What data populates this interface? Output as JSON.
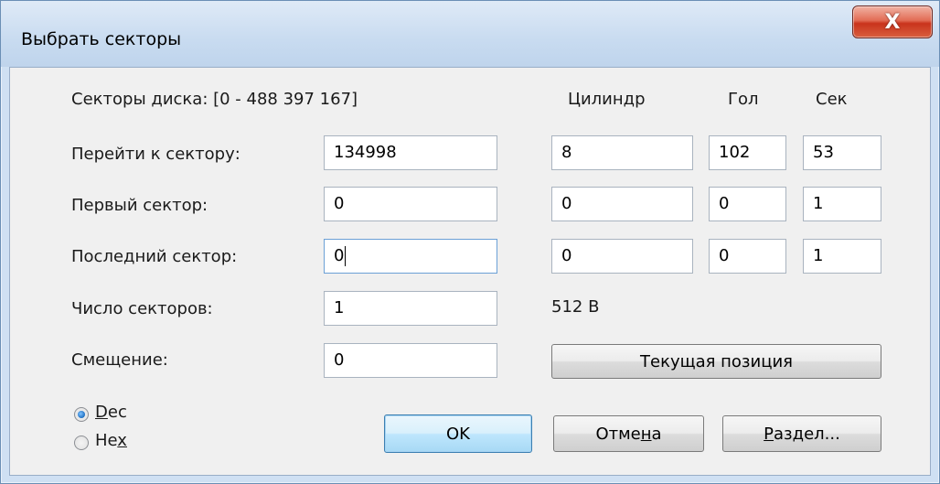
{
  "window": {
    "title": "Выбрать секторы",
    "close_label": "X"
  },
  "header": {
    "disk_range": "Секторы диска: [0 - 488 397 167]",
    "col_cylinder": "Цилиндр",
    "col_head": "Гол",
    "col_sector": "Сек"
  },
  "rows": {
    "goto": {
      "label": "Перейти к сектору:",
      "value": "134998",
      "cyl": "8",
      "head": "102",
      "sec": "53"
    },
    "first": {
      "label": "Первый сектор:",
      "value": "0",
      "cyl": "0",
      "head": "0",
      "sec": "1"
    },
    "last": {
      "label": "Последний сектор:",
      "value": "0",
      "cyl": "0",
      "head": "0",
      "sec": "1"
    },
    "count": {
      "label": "Число секторов:",
      "value": "1",
      "size": "512 B"
    },
    "offset": {
      "label": "Смещение:",
      "value": "0"
    }
  },
  "buttons": {
    "current_position": "Текущая позиция",
    "ok": "OK",
    "cancel_pre": "Отме",
    "cancel_u": "н",
    "cancel_post": "а",
    "partition_u": "Р",
    "partition_post": "аздел..."
  },
  "radix": {
    "dec_u": "D",
    "dec_post": "ec",
    "hex_pre": "He",
    "hex_u": "x",
    "selected": "Dec"
  }
}
